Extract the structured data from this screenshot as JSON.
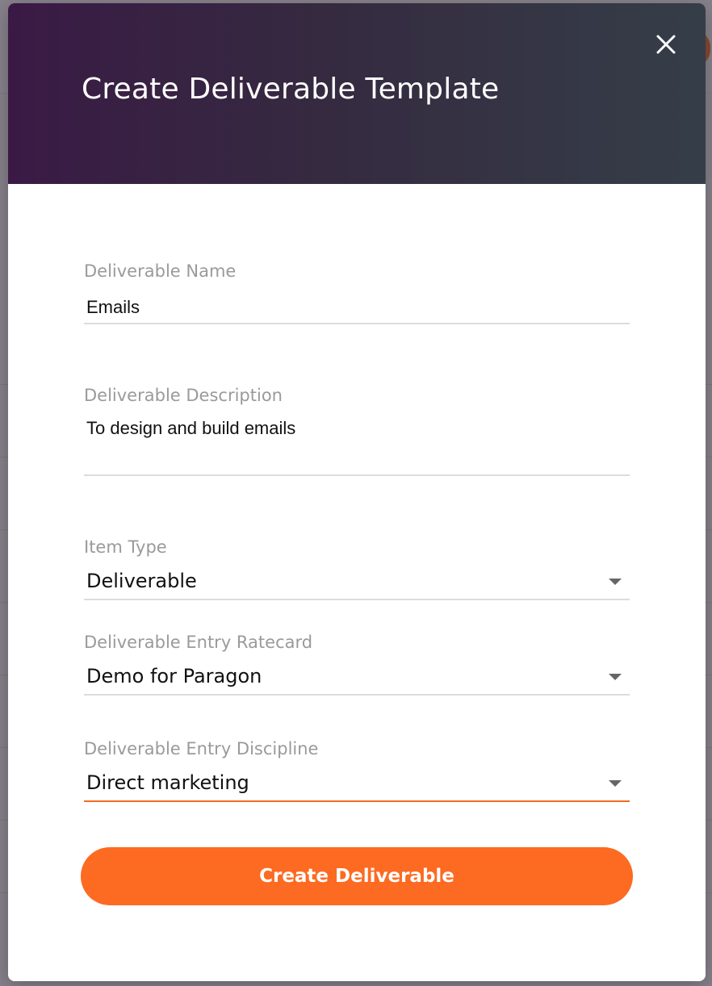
{
  "modal": {
    "title": "Create Deliverable Template",
    "close_icon": "close-icon"
  },
  "form": {
    "name": {
      "label": "Deliverable Name",
      "value": "Emails"
    },
    "description": {
      "label": "Deliverable Description",
      "value": "To design and build emails"
    },
    "item_type": {
      "label": "Item Type",
      "value": "Deliverable",
      "icon": "chevron-down-icon"
    },
    "ratecard": {
      "label": "Deliverable Entry Ratecard",
      "value": "Demo for Paragon",
      "icon": "chevron-down-icon"
    },
    "discipline": {
      "label": "Deliverable Entry Discipline",
      "value": "Direct marketing",
      "icon": "chevron-down-icon"
    },
    "submit_label": "Create Deliverable"
  },
  "colors": {
    "accent": "#fd6a21",
    "header_start": "#3a1a45",
    "header_end": "#353e48"
  }
}
